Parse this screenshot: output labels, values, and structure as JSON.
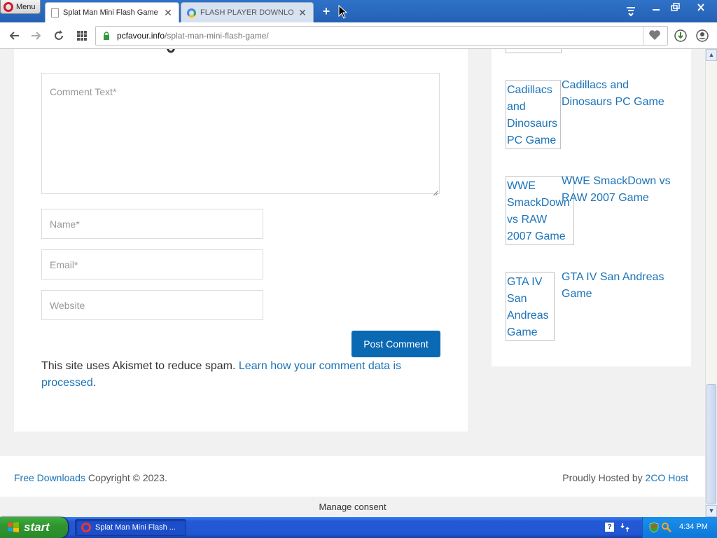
{
  "browser": {
    "menu_label": "Menu",
    "tabs": [
      {
        "title": "Splat Man Mini Flash Game",
        "close": "✕",
        "active": true
      },
      {
        "title": "FLASH PLAYER DOWNLOAD",
        "close": "✕",
        "active": false
      }
    ],
    "new_tab": "+",
    "url_host": "pcfavour.info",
    "url_path": "/splat-man-mini-flash-game/",
    "accent": "#2461b5"
  },
  "page": {
    "comment_form": {
      "comment_placeholder": "Comment Text*",
      "name_placeholder": "Name*",
      "email_placeholder": "Email*",
      "website_placeholder": "Website",
      "submit_label": "Post Comment",
      "submit_color": "#0a69b3"
    },
    "akismet": {
      "text": "This site uses Akismet to reduce spam. ",
      "link": "Learn how your comment data is processed",
      "end": "."
    },
    "sidebar_posts": [
      {
        "thumb_text": "Cadillacs and Dinosaurs PC Game",
        "title": "Cadillacs and Dinosaurs PC Game"
      },
      {
        "thumb_text": "WWE SmackDown vs RAW 2007 Game",
        "title": "WWE SmackDown vs RAW 2007 Game"
      },
      {
        "thumb_text": "GTA IV San Andreas Game",
        "title": "GTA IV San Andreas Game"
      }
    ],
    "link_color": "#1a73b8",
    "footer": {
      "left_link": "Free Downloads",
      "left_text": " Copyright © 2023.",
      "right_text": "Proudly Hosted by ",
      "right_link": "2CO Host"
    },
    "consent": "Manage consent"
  },
  "taskbar": {
    "start_label": "start",
    "item_label": "Splat Man Mini Flash ...",
    "clock": "4:34 PM"
  }
}
